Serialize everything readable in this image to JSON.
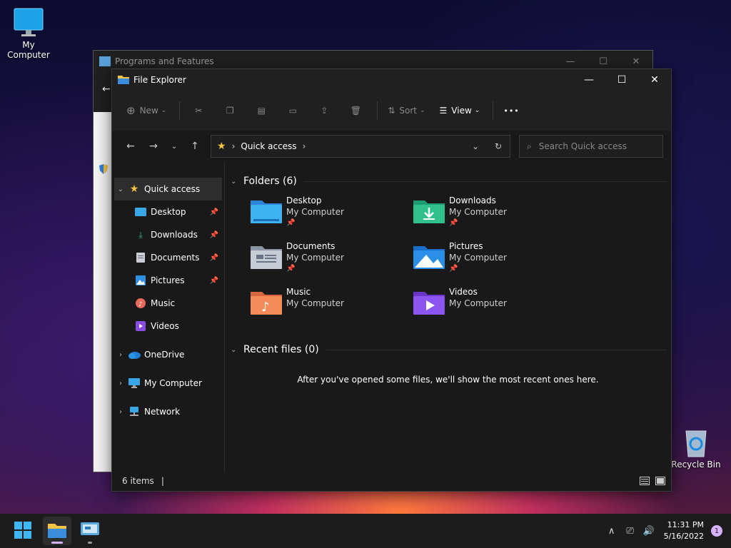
{
  "desktop": {
    "my_computer_label": "My Computer",
    "recycle_bin_label": "Recycle Bin"
  },
  "programs_window": {
    "title": "Programs and Features"
  },
  "explorer": {
    "title": "File Explorer",
    "cmd": {
      "new_label": "New",
      "sort_label": "Sort",
      "view_label": "View",
      "more_label": "•••"
    },
    "address": {
      "location": "Quick access"
    },
    "search": {
      "placeholder": "Search Quick access"
    },
    "nav": {
      "quick_access": "Quick access",
      "pinned": [
        {
          "label": "Desktop"
        },
        {
          "label": "Downloads"
        },
        {
          "label": "Documents"
        },
        {
          "label": "Pictures"
        }
      ],
      "music": "Music",
      "videos": "Videos",
      "onedrive": "OneDrive",
      "my_computer": "My Computer",
      "network": "Network"
    },
    "folders_header": "Folders (6)",
    "folders": [
      {
        "name": "Desktop",
        "location": "My Computer"
      },
      {
        "name": "Downloads",
        "location": "My Computer"
      },
      {
        "name": "Documents",
        "location": "My Computer"
      },
      {
        "name": "Pictures",
        "location": "My Computer"
      },
      {
        "name": "Music",
        "location": "My Computer"
      },
      {
        "name": "Videos",
        "location": "My Computer"
      }
    ],
    "recent_header": "Recent files (0)",
    "recent_empty": "After you've opened some files, we'll show the most recent ones here.",
    "status_items": "6 items"
  },
  "taskbar": {
    "time": "11:31 PM",
    "date": "5/16/2022",
    "notification_count": "1"
  },
  "colors": {
    "accent": "#0078d4",
    "folder_yellow": "#f6c344",
    "taskbar_bg": "#1c1c1c",
    "explorer_bg": "#191919"
  }
}
